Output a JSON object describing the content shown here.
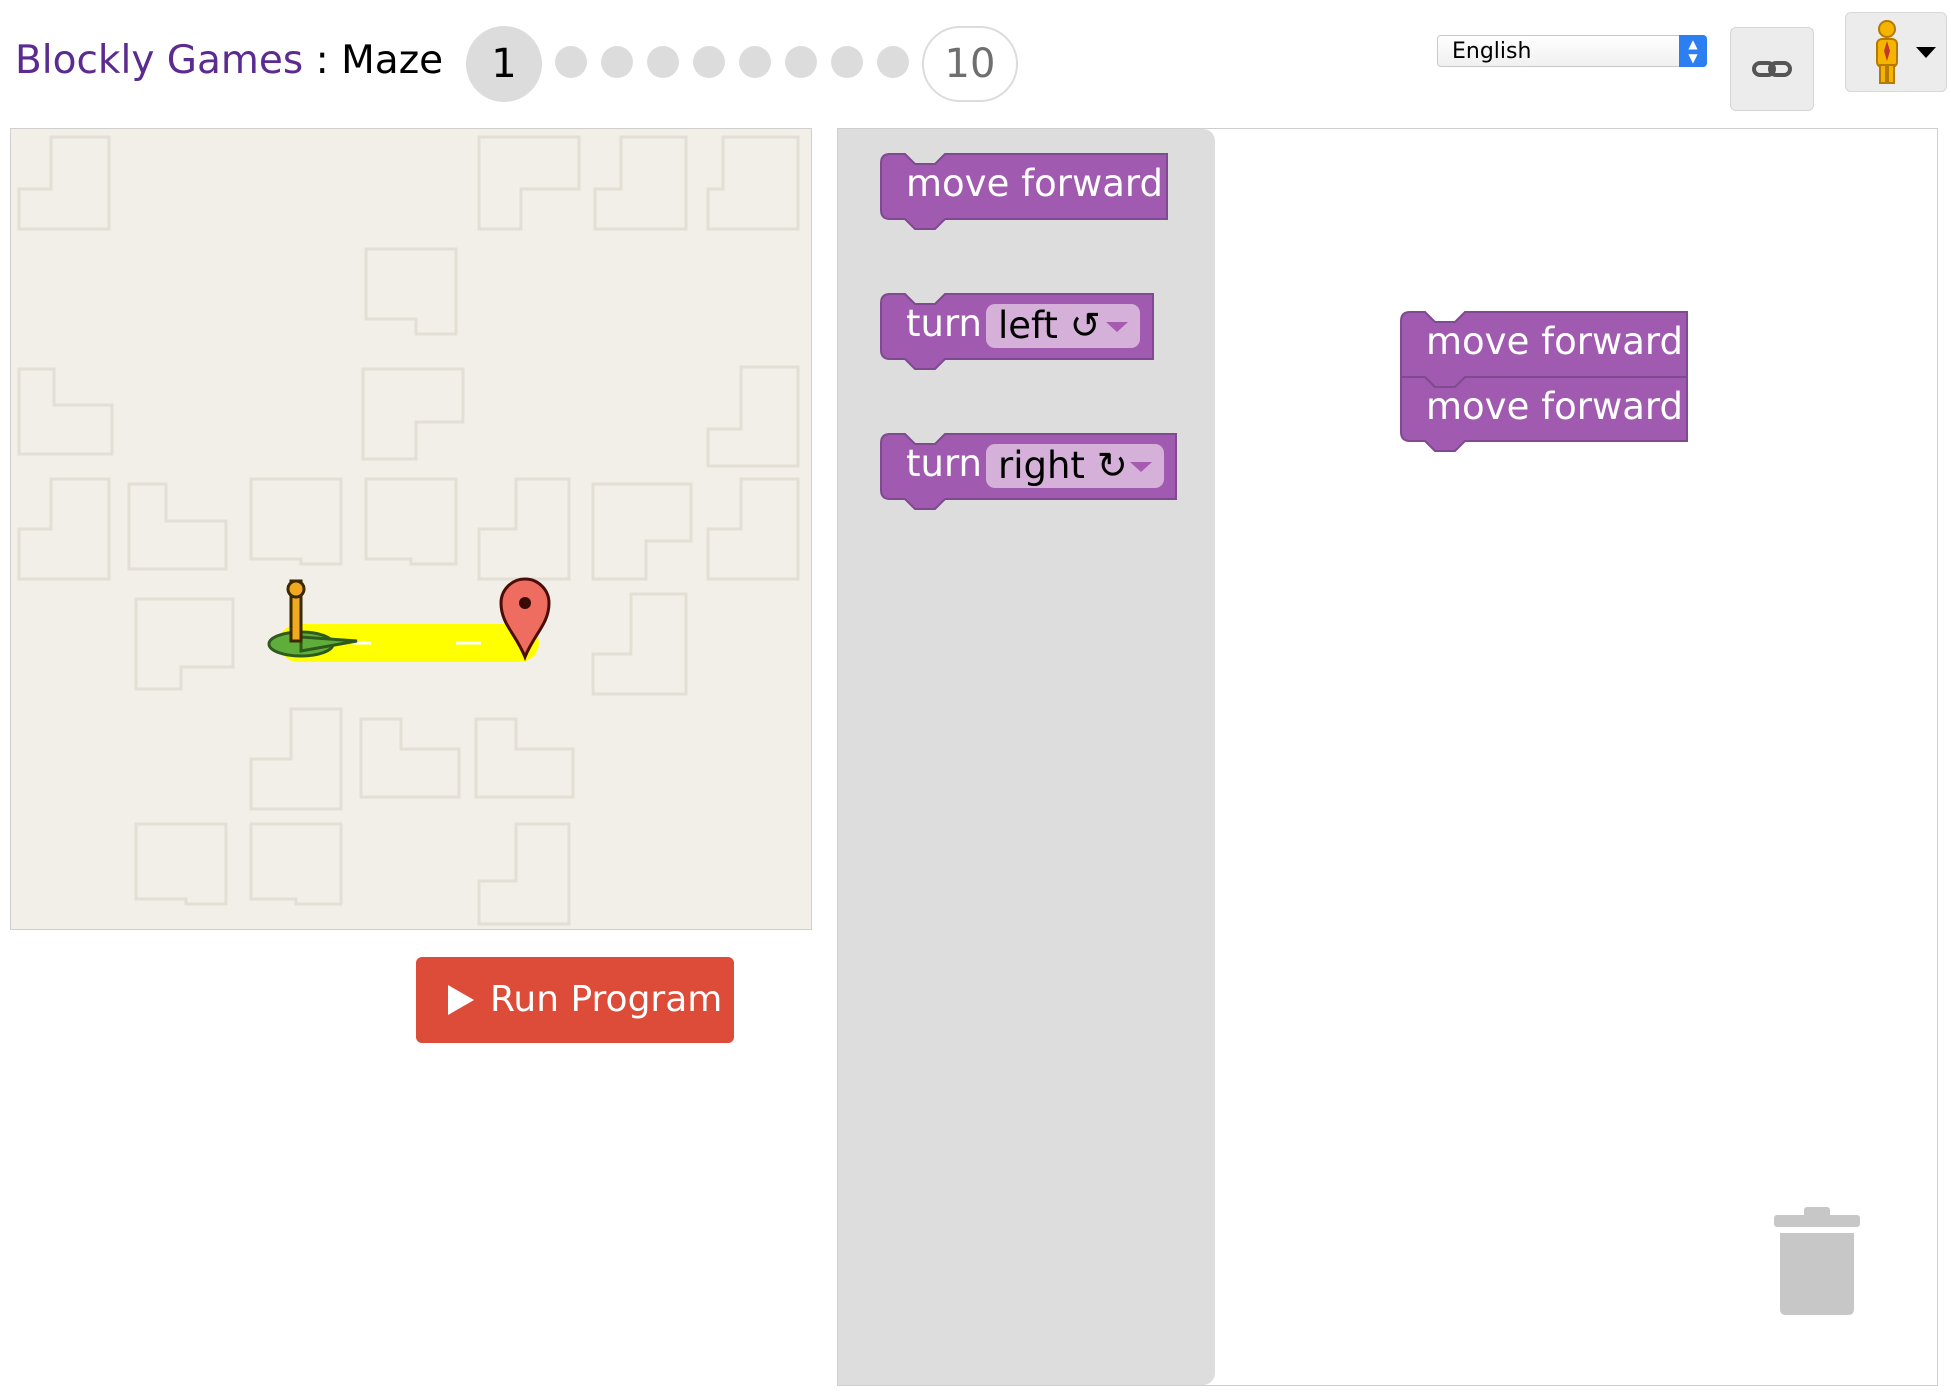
{
  "header": {
    "brand": "Blockly Games",
    "separator": " : ",
    "game": "Maze",
    "levels": {
      "current": "1",
      "last": "10",
      "intermediate_count": 8
    }
  },
  "language": {
    "selected": "English"
  },
  "toolbar": {
    "link_icon": "link-icon",
    "pegman_icon": "pegman-icon"
  },
  "maze": {
    "start_icon": "pegman-start-marker",
    "goal_icon": "red-map-pin",
    "path_color": "#ffff00"
  },
  "run_button": {
    "label": "Run Program"
  },
  "toolbox": {
    "blocks": [
      {
        "label": "move forward"
      },
      {
        "label": "turn",
        "dropdown": "left ↺"
      },
      {
        "label": "turn",
        "dropdown": "right ↻"
      }
    ]
  },
  "workspace": {
    "stack": [
      {
        "label": "move forward"
      },
      {
        "label": "move forward"
      }
    ]
  },
  "colors": {
    "block": "#a05aaf",
    "block_border": "#7f4a8f",
    "dropdown": "#d5b0d8",
    "brand": "#5c2b8f",
    "run": "#dd4b39",
    "flyout": "#dddddd",
    "maze_bg": "#f1efe8"
  }
}
